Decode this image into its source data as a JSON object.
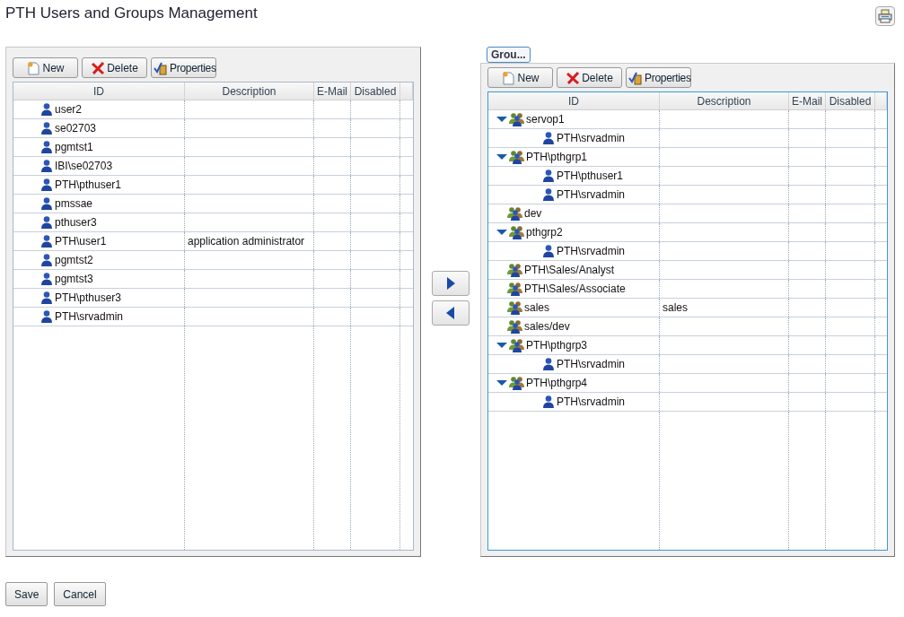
{
  "page": {
    "title": "PTH Users and Groups Management"
  },
  "users_panel": {
    "toolbar": [
      "New",
      "Delete",
      "Properties"
    ],
    "columns": [
      "ID",
      "Description",
      "E-Mail",
      "Disabled"
    ],
    "rows": [
      {
        "id": "user2"
      },
      {
        "id": "se02703"
      },
      {
        "id": "pgmtst1"
      },
      {
        "id": "IBI\\se02703"
      },
      {
        "id": "PTH\\pthuser1"
      },
      {
        "id": "pmssae"
      },
      {
        "id": "pthuser3"
      },
      {
        "id": "PTH\\user1",
        "description": "application administrator"
      },
      {
        "id": "pgmtst2"
      },
      {
        "id": "pgmtst3"
      },
      {
        "id": "PTH\\pthuser3"
      },
      {
        "id": "PTH\\srvadmin"
      }
    ]
  },
  "transfer_buttons": [
    {
      "kind": "add"
    },
    {
      "kind": "remove"
    }
  ],
  "groups_panel": {
    "tab": "Grou...",
    "toolbar": [
      "New",
      "Delete",
      "Properties"
    ],
    "columns": [
      "ID",
      "Description",
      "E-Mail",
      "Disabled"
    ],
    "rows": [
      {
        "kind": "group",
        "id": "servop1",
        "expanded": true,
        "children": [
          {
            "kind": "user",
            "id": "PTH\\srvadmin"
          }
        ]
      },
      {
        "kind": "group",
        "id": "PTH\\pthgrp1",
        "expanded": true,
        "children": [
          {
            "kind": "user",
            "id": "PTH\\pthuser1"
          },
          {
            "kind": "user",
            "id": "PTH\\srvadmin"
          }
        ]
      },
      {
        "kind": "group",
        "id": "dev"
      },
      {
        "kind": "group",
        "id": "pthgrp2",
        "expanded": true,
        "children": [
          {
            "kind": "user",
            "id": "PTH\\srvadmin"
          }
        ]
      },
      {
        "kind": "group",
        "id": "PTH\\Sales/Analyst"
      },
      {
        "kind": "group",
        "id": "PTH\\Sales/Associate"
      },
      {
        "kind": "group",
        "id": "sales",
        "description": "sales"
      },
      {
        "kind": "group",
        "id": "sales/dev"
      },
      {
        "kind": "group",
        "id": "PTH\\pthgrp3",
        "expanded": true,
        "children": [
          {
            "kind": "user",
            "id": "PTH\\srvadmin"
          }
        ]
      },
      {
        "kind": "group",
        "id": "PTH\\pthgrp4",
        "expanded": true,
        "children": [
          {
            "kind": "user",
            "id": "PTH\\srvadmin"
          }
        ]
      }
    ]
  },
  "footer_buttons": [
    "Save",
    "Cancel"
  ]
}
